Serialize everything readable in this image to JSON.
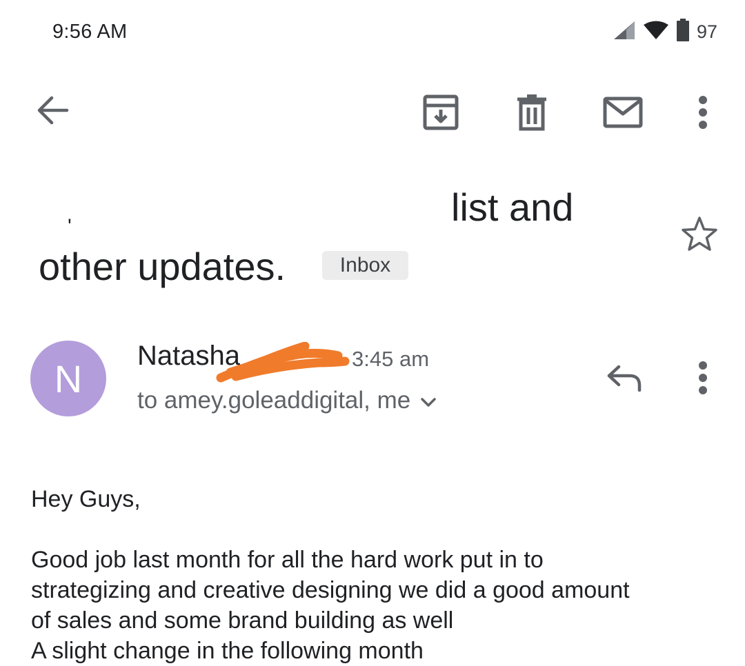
{
  "status_bar": {
    "time": "9:56 AM",
    "battery_level": "97",
    "icons": [
      "cell-signal-icon",
      "wifi-icon",
      "battery-icon"
    ]
  },
  "toolbar": {
    "icons": [
      "back-arrow-icon",
      "archive-icon",
      "delete-icon",
      "mark-unread-icon",
      "more-vert-icon"
    ]
  },
  "subject": {
    "line1": "list and",
    "fragment": "'",
    "line2": "other updates.",
    "label": "Inbox",
    "star_icon": "star-outline-icon"
  },
  "sender": {
    "avatar_letter": "N",
    "name": "Natasha",
    "time": "3:45 am",
    "recipients": "to amey.goleaddigital, me",
    "actions": [
      "reply-icon",
      "more-vert-icon"
    ]
  },
  "body": {
    "greeting": "Hey Guys,",
    "line1": "Good job last month for all the hard work put in to",
    "line2": "strategizing and creative designing  we did a good amount",
    "line3": "of sales and some brand building as well",
    "line4": "A slight change in the following month"
  },
  "colors": {
    "avatar_bg": "#b39ddb",
    "redaction": "#f07b2b",
    "icon_gray": "#5f6368",
    "chip_bg": "#ececec"
  }
}
